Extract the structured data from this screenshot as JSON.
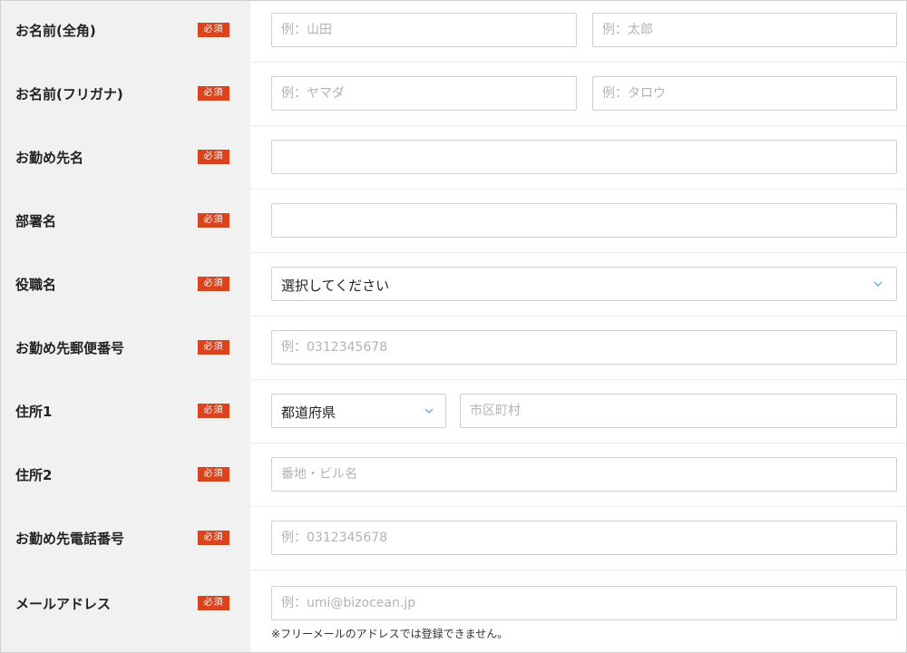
{
  "required_badge": "必須",
  "rows": {
    "name_kanji": {
      "label": "お名前(全角)",
      "last_placeholder": "例：山田",
      "first_placeholder": "例：太郎"
    },
    "name_kana": {
      "label": "お名前(フリガナ)",
      "last_placeholder": "例：ヤマダ",
      "first_placeholder": "例：タロウ"
    },
    "company": {
      "label": "お勤め先名",
      "value": ""
    },
    "department": {
      "label": "部署名",
      "value": ""
    },
    "position": {
      "label": "役職名",
      "selected": "選択してください"
    },
    "postal": {
      "label": "お勤め先郵便番号",
      "placeholder": "例：0312345678"
    },
    "address1": {
      "label": "住所1",
      "prefecture_selected": "都道府県",
      "city_placeholder": "市区町村"
    },
    "address2": {
      "label": "住所2",
      "placeholder": "番地・ビル名"
    },
    "phone": {
      "label": "お勤め先電話番号",
      "placeholder": "例：0312345678"
    },
    "email": {
      "label": "メールアドレス",
      "placeholder": "例：umi@bizocean.jp",
      "note": "※フリーメールのアドレスでは登録できません。"
    }
  },
  "colors": {
    "badge": "#d9431e",
    "label_bg": "#f1f1f1",
    "chevron": "#4aa3c8"
  },
  "icons": {
    "dropdown": "chevron-down-icon"
  }
}
